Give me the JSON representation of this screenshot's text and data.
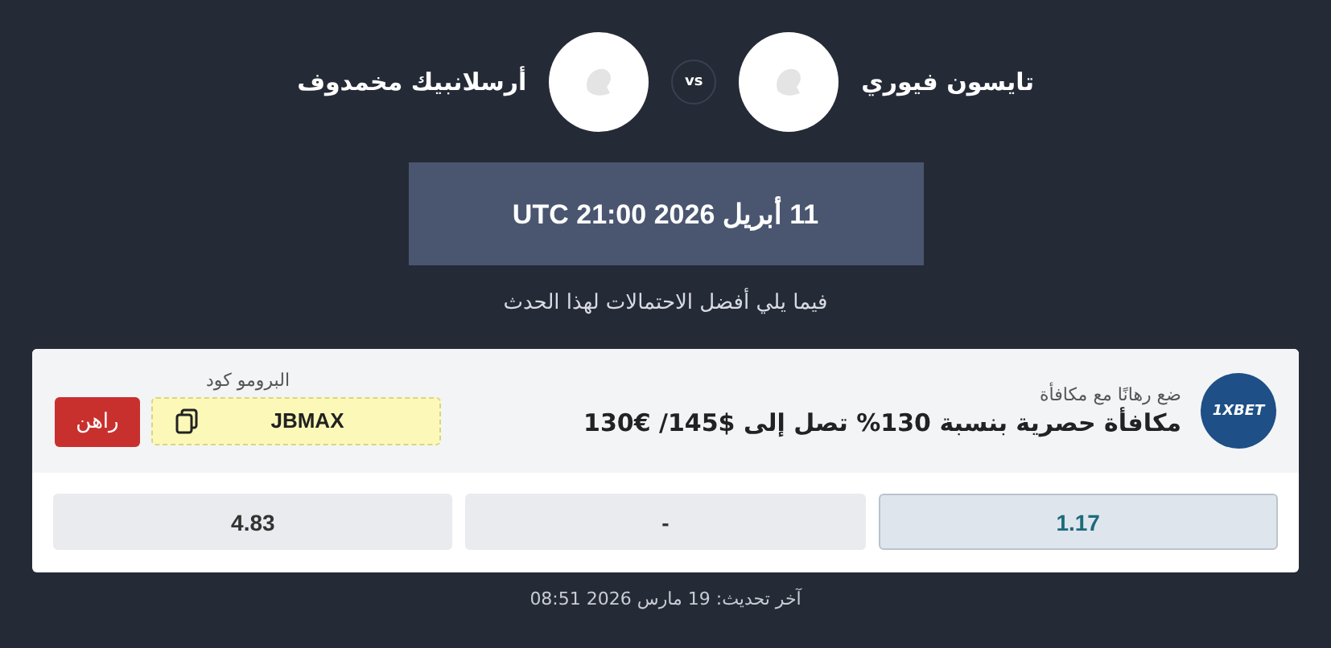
{
  "match": {
    "fighters": [
      {
        "name": "تايسون فيوري"
      },
      {
        "name": "أرسلانبيك مخمدوف"
      }
    ],
    "vs": "vs",
    "date": "11 أبريل 2026 21:00 UTC",
    "subtitle": "فيما يلي أفضل الاحتمالات لهذا الحدث"
  },
  "offer": {
    "logo": "1XBET",
    "tagline": "ضع رهانًا مع مكافأة",
    "title": "مكافأة حصرية بنسبة 130% تصل إلى $145/ €130",
    "promo_label": "البرومو كود",
    "promo_code": "JBMAX",
    "bet_button": "راهن"
  },
  "odds": [
    {
      "value": "1.17",
      "selected": true
    },
    {
      "value": "-",
      "selected": false
    },
    {
      "value": "4.83",
      "selected": false
    }
  ],
  "last_update": "آخر تحديث: 19 مارس 2026 08:51"
}
